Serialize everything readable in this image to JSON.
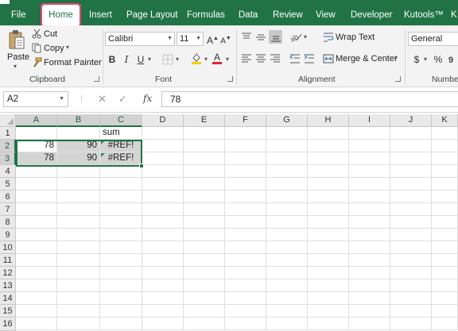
{
  "ribbon_tabs": [
    "File",
    "Home",
    "Insert",
    "Page Layout",
    "Formulas",
    "Data",
    "Review",
    "View",
    "Developer",
    "Kutools™",
    "K"
  ],
  "clipboard": {
    "paste_label": "Paste",
    "cut_label": "Cut",
    "copy_label": "Copy",
    "format_painter_label": "Format Painter",
    "group_label": "Clipboard"
  },
  "font": {
    "name": "Calibri",
    "size": "11",
    "bold": "B",
    "italic": "I",
    "underline": "U",
    "group_label": "Font"
  },
  "alignment": {
    "wrap_text_label": "Wrap Text",
    "merge_center_label": "Merge & Center",
    "group_label": "Alignment"
  },
  "number": {
    "format": "General",
    "currency_symbol": "$",
    "percent_symbol": "%",
    "group_label": "Numbe"
  },
  "formula_bar": {
    "name_box": "A2",
    "fx_label": "fx",
    "value": "78"
  },
  "columns": [
    "A",
    "B",
    "C",
    "D",
    "E",
    "F",
    "G",
    "H",
    "I",
    "J",
    "K"
  ],
  "rows": [
    "1",
    "2",
    "3",
    "4",
    "5",
    "6",
    "7",
    "8",
    "9",
    "10",
    "11",
    "12",
    "13",
    "14",
    "15",
    "16"
  ],
  "cells": {
    "C1": "sum",
    "A2": "78",
    "B2": "90",
    "C2": "#REF!",
    "A3": "78",
    "B3": "90",
    "C3": "#REF!"
  },
  "colors": {
    "accent": "#217346",
    "highlight_outline": "#e0467a",
    "selection_fill": "#d4d4d4"
  }
}
